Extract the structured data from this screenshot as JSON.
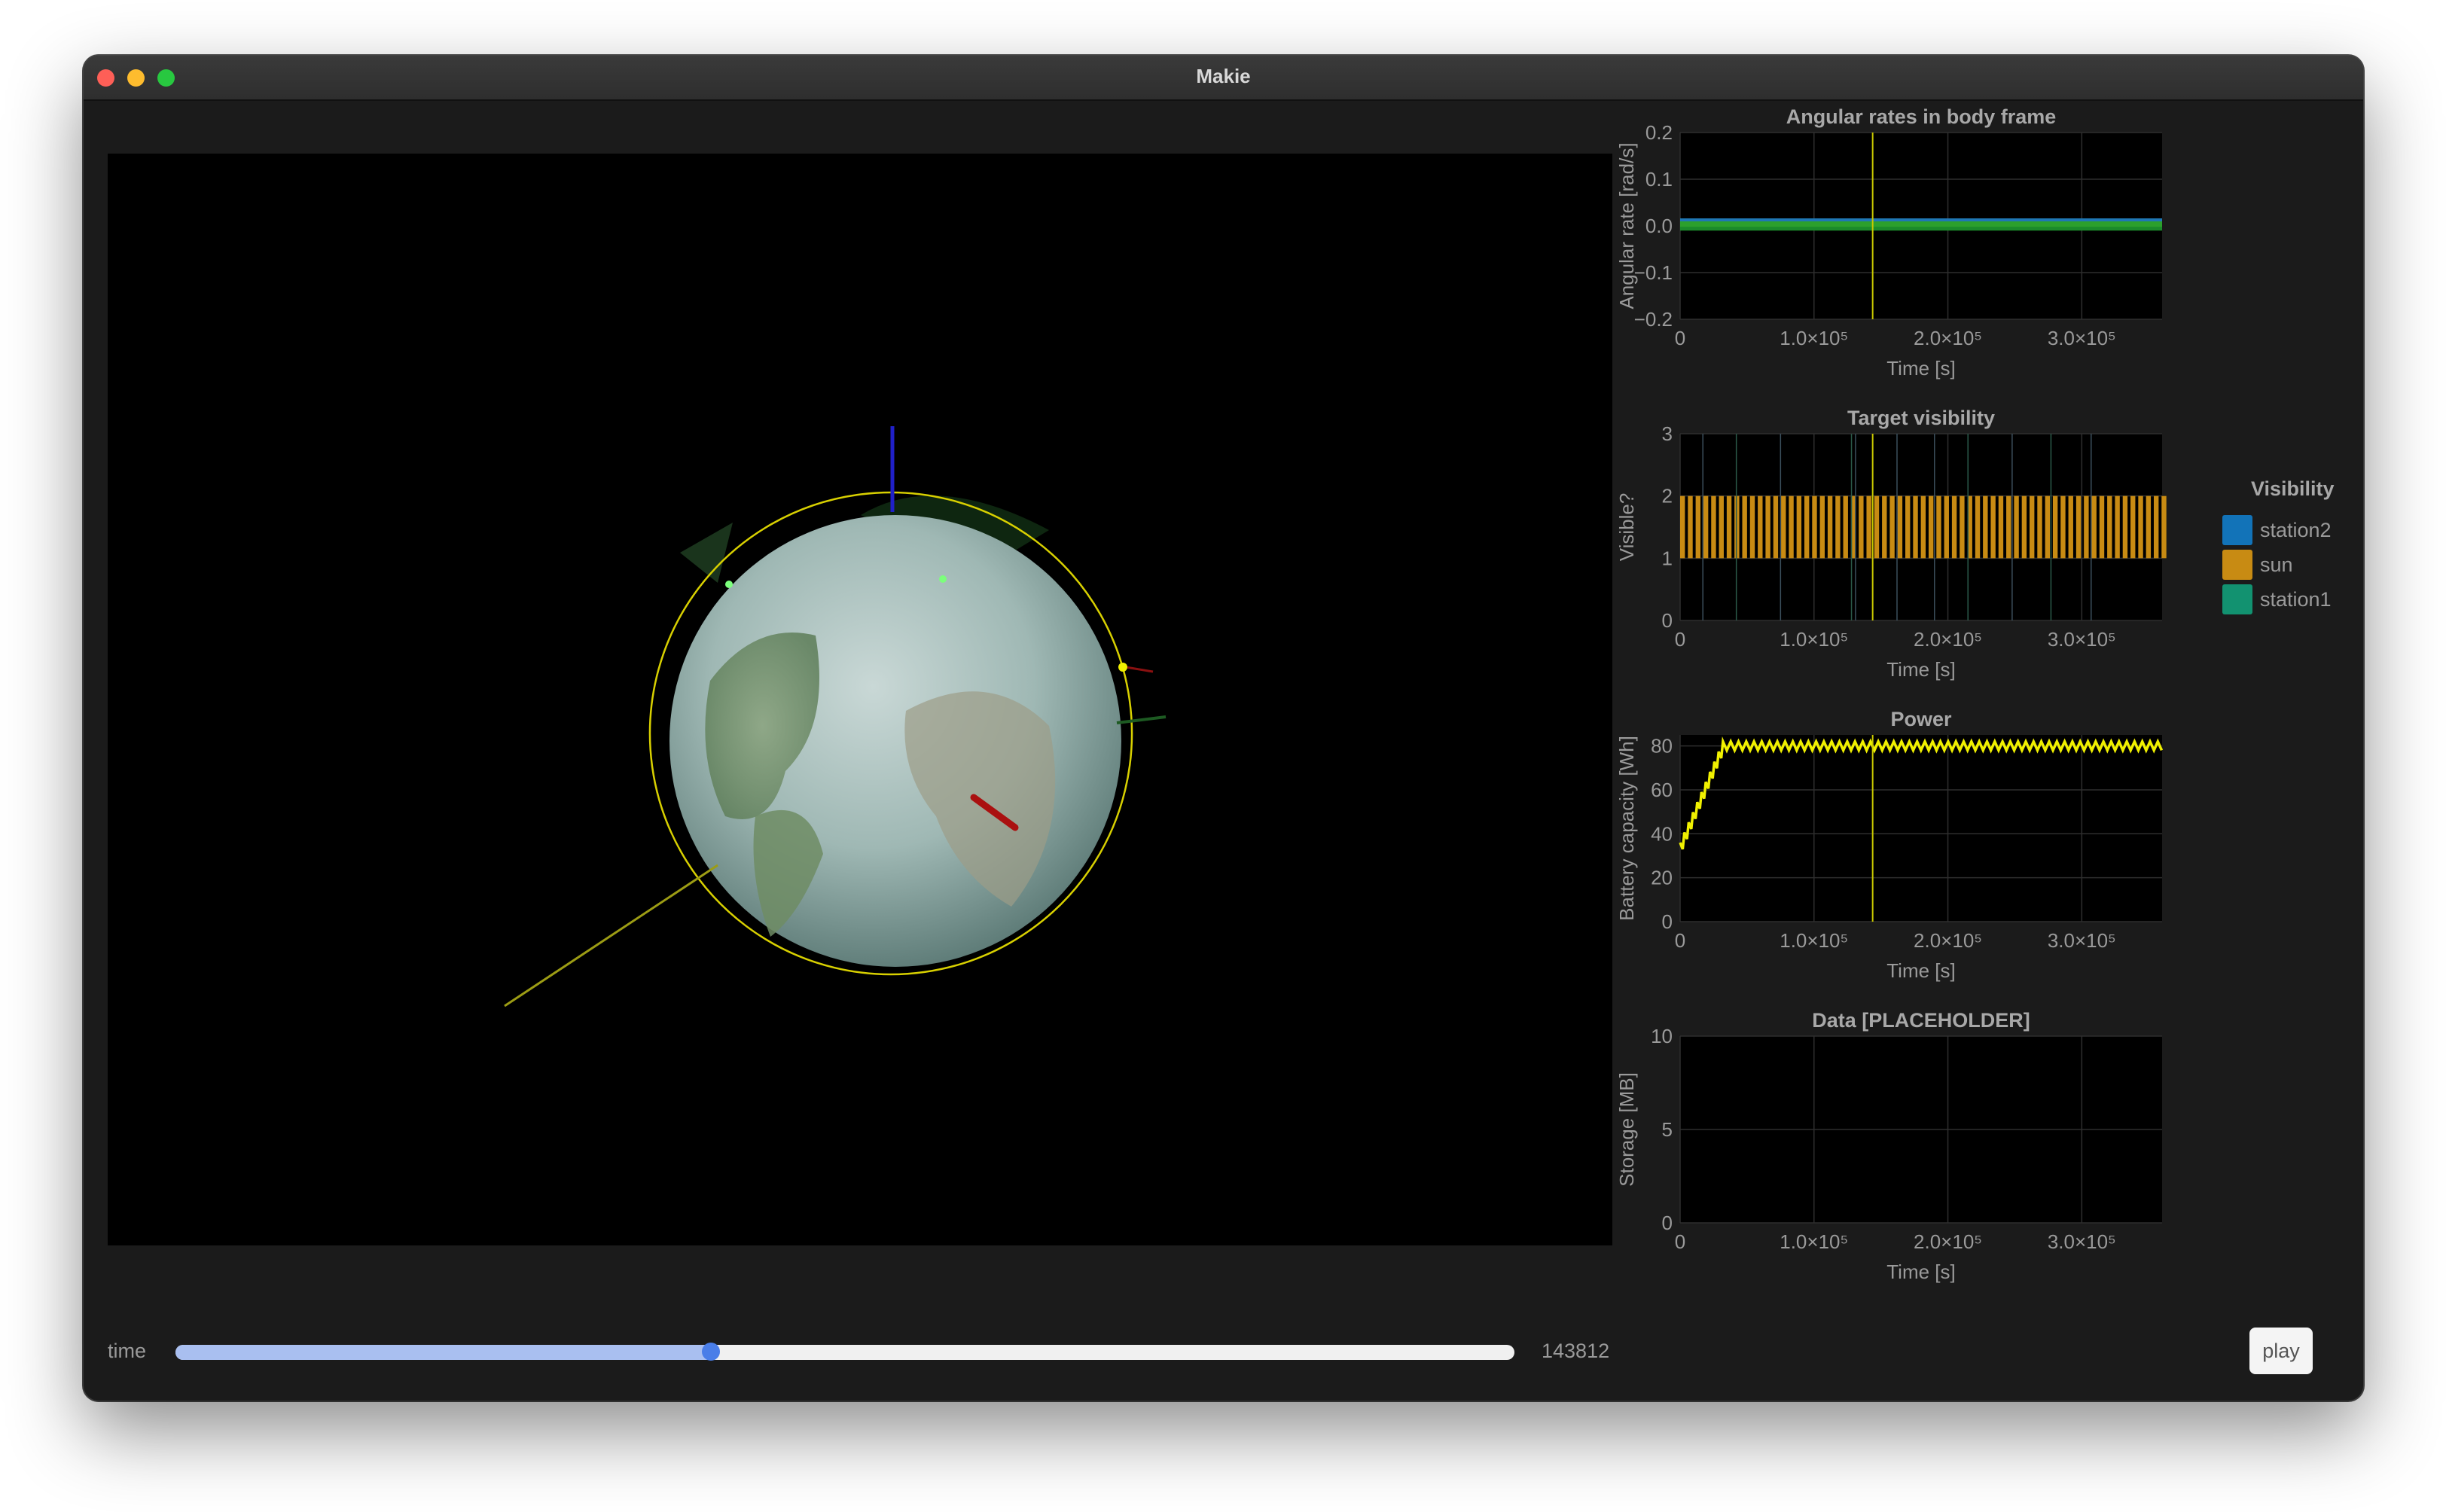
{
  "window": {
    "title": "Makie"
  },
  "controls": {
    "time_label": "time",
    "time_value": "143812",
    "slider_fraction": 0.4,
    "play_label": "play"
  },
  "legend": {
    "title": "Visibility",
    "items": [
      {
        "label": "station2",
        "color": "#1273b8"
      },
      {
        "label": "sun",
        "color": "#c88b13"
      },
      {
        "label": "station1",
        "color": "#129270"
      }
    ]
  },
  "colors": {
    "background": "#1b1b1b",
    "plot_background": "#000000",
    "grid": "#2e2e2e",
    "cursor_line": "#c8c800",
    "orbit": "#d8d000",
    "slider_fill": "#a9bff0",
    "slider_knob": "#4a7ee8"
  },
  "chart_data": [
    {
      "type": "line",
      "title": "Angular rates in body frame",
      "xlabel": "Time [s]",
      "ylabel": "Angular rate [rad/s]",
      "xlim": [
        0,
        360000
      ],
      "ylim": [
        -0.2,
        0.2
      ],
      "xticks": [
        {
          "value": 0,
          "label": "0"
        },
        {
          "value": 100000,
          "label": "1.0×10⁵"
        },
        {
          "value": 200000,
          "label": "2.0×10⁵"
        },
        {
          "value": 300000,
          "label": "3.0×10⁵"
        }
      ],
      "yticks": [
        {
          "value": -0.2,
          "label": "−0.2"
        },
        {
          "value": -0.1,
          "label": "−0.1"
        },
        {
          "value": 0.0,
          "label": "0.0"
        },
        {
          "value": 0.1,
          "label": "0.1"
        },
        {
          "value": 0.2,
          "label": "0.2"
        }
      ],
      "cursor_x": 143812,
      "series": [
        {
          "color": "#1f77b4",
          "x": [
            0,
            360000
          ],
          "y": [
            0.012,
            0.012
          ]
        },
        {
          "color": "#2ca02c",
          "x": [
            0,
            360000
          ],
          "y": [
            0.0,
            0.0
          ]
        },
        {
          "color": "#1b8a2a",
          "x": [
            0,
            360000
          ],
          "y": [
            -0.006,
            -0.006
          ]
        }
      ],
      "grid": true
    },
    {
      "type": "bar",
      "title": "Target visibility",
      "xlabel": "Time [s]",
      "ylabel": "Visible?",
      "xlim": [
        0,
        360000
      ],
      "ylim": [
        0,
        3
      ],
      "xticks": [
        {
          "value": 0,
          "label": "0"
        },
        {
          "value": 100000,
          "label": "1.0×10⁵"
        },
        {
          "value": 200000,
          "label": "2.0×10⁵"
        },
        {
          "value": 300000,
          "label": "3.0×10⁵"
        }
      ],
      "yticks": [
        {
          "value": 0,
          "label": "0"
        },
        {
          "value": 1,
          "label": "1"
        },
        {
          "value": 2,
          "label": "2"
        },
        {
          "value": 3,
          "label": "3"
        }
      ],
      "cursor_x": 143812,
      "sun_band": {
        "low": 1,
        "high": 2,
        "period": 5800,
        "duty": 0.62,
        "color": "#c88b13"
      },
      "station2_passes": [
        17000,
        75000,
        131000,
        162000,
        190000,
        248000,
        307000
      ],
      "station1_passes": [
        42000,
        128000,
        215000,
        277000
      ],
      "grid": true
    },
    {
      "type": "line",
      "title": "Power",
      "xlabel": "Time [s]",
      "ylabel": "Battery capacity [Wh]",
      "xlim": [
        0,
        360000
      ],
      "ylim": [
        0,
        85
      ],
      "xticks": [
        {
          "value": 0,
          "label": "0"
        },
        {
          "value": 100000,
          "label": "1.0×10⁵"
        },
        {
          "value": 200000,
          "label": "2.0×10⁵"
        },
        {
          "value": 300000,
          "label": "3.0×10⁵"
        }
      ],
      "yticks": [
        {
          "value": 0,
          "label": "0"
        },
        {
          "value": 20,
          "label": "20"
        },
        {
          "value": 40,
          "label": "40"
        },
        {
          "value": 60,
          "label": "60"
        },
        {
          "value": 80,
          "label": "80"
        }
      ],
      "cursor_x": 143812,
      "series": [
        {
          "color": "#f0f000",
          "start": 36,
          "max": 82,
          "min_dip": 78,
          "period": 5800,
          "rise_end": 32000
        }
      ],
      "grid": true
    },
    {
      "type": "line",
      "title": "Data [PLACEHOLDER]",
      "xlabel": "Time [s]",
      "ylabel": "Storage [MB]",
      "xlim": [
        0,
        360000
      ],
      "ylim": [
        0,
        10
      ],
      "xticks": [
        {
          "value": 0,
          "label": "0"
        },
        {
          "value": 100000,
          "label": "1.0×10⁵"
        },
        {
          "value": 200000,
          "label": "2.0×10⁵"
        },
        {
          "value": 300000,
          "label": "3.0×10⁵"
        }
      ],
      "yticks": [
        {
          "value": 0,
          "label": "0"
        },
        {
          "value": 5,
          "label": "5"
        },
        {
          "value": 10,
          "label": "10"
        }
      ],
      "series": [],
      "grid": true
    }
  ]
}
